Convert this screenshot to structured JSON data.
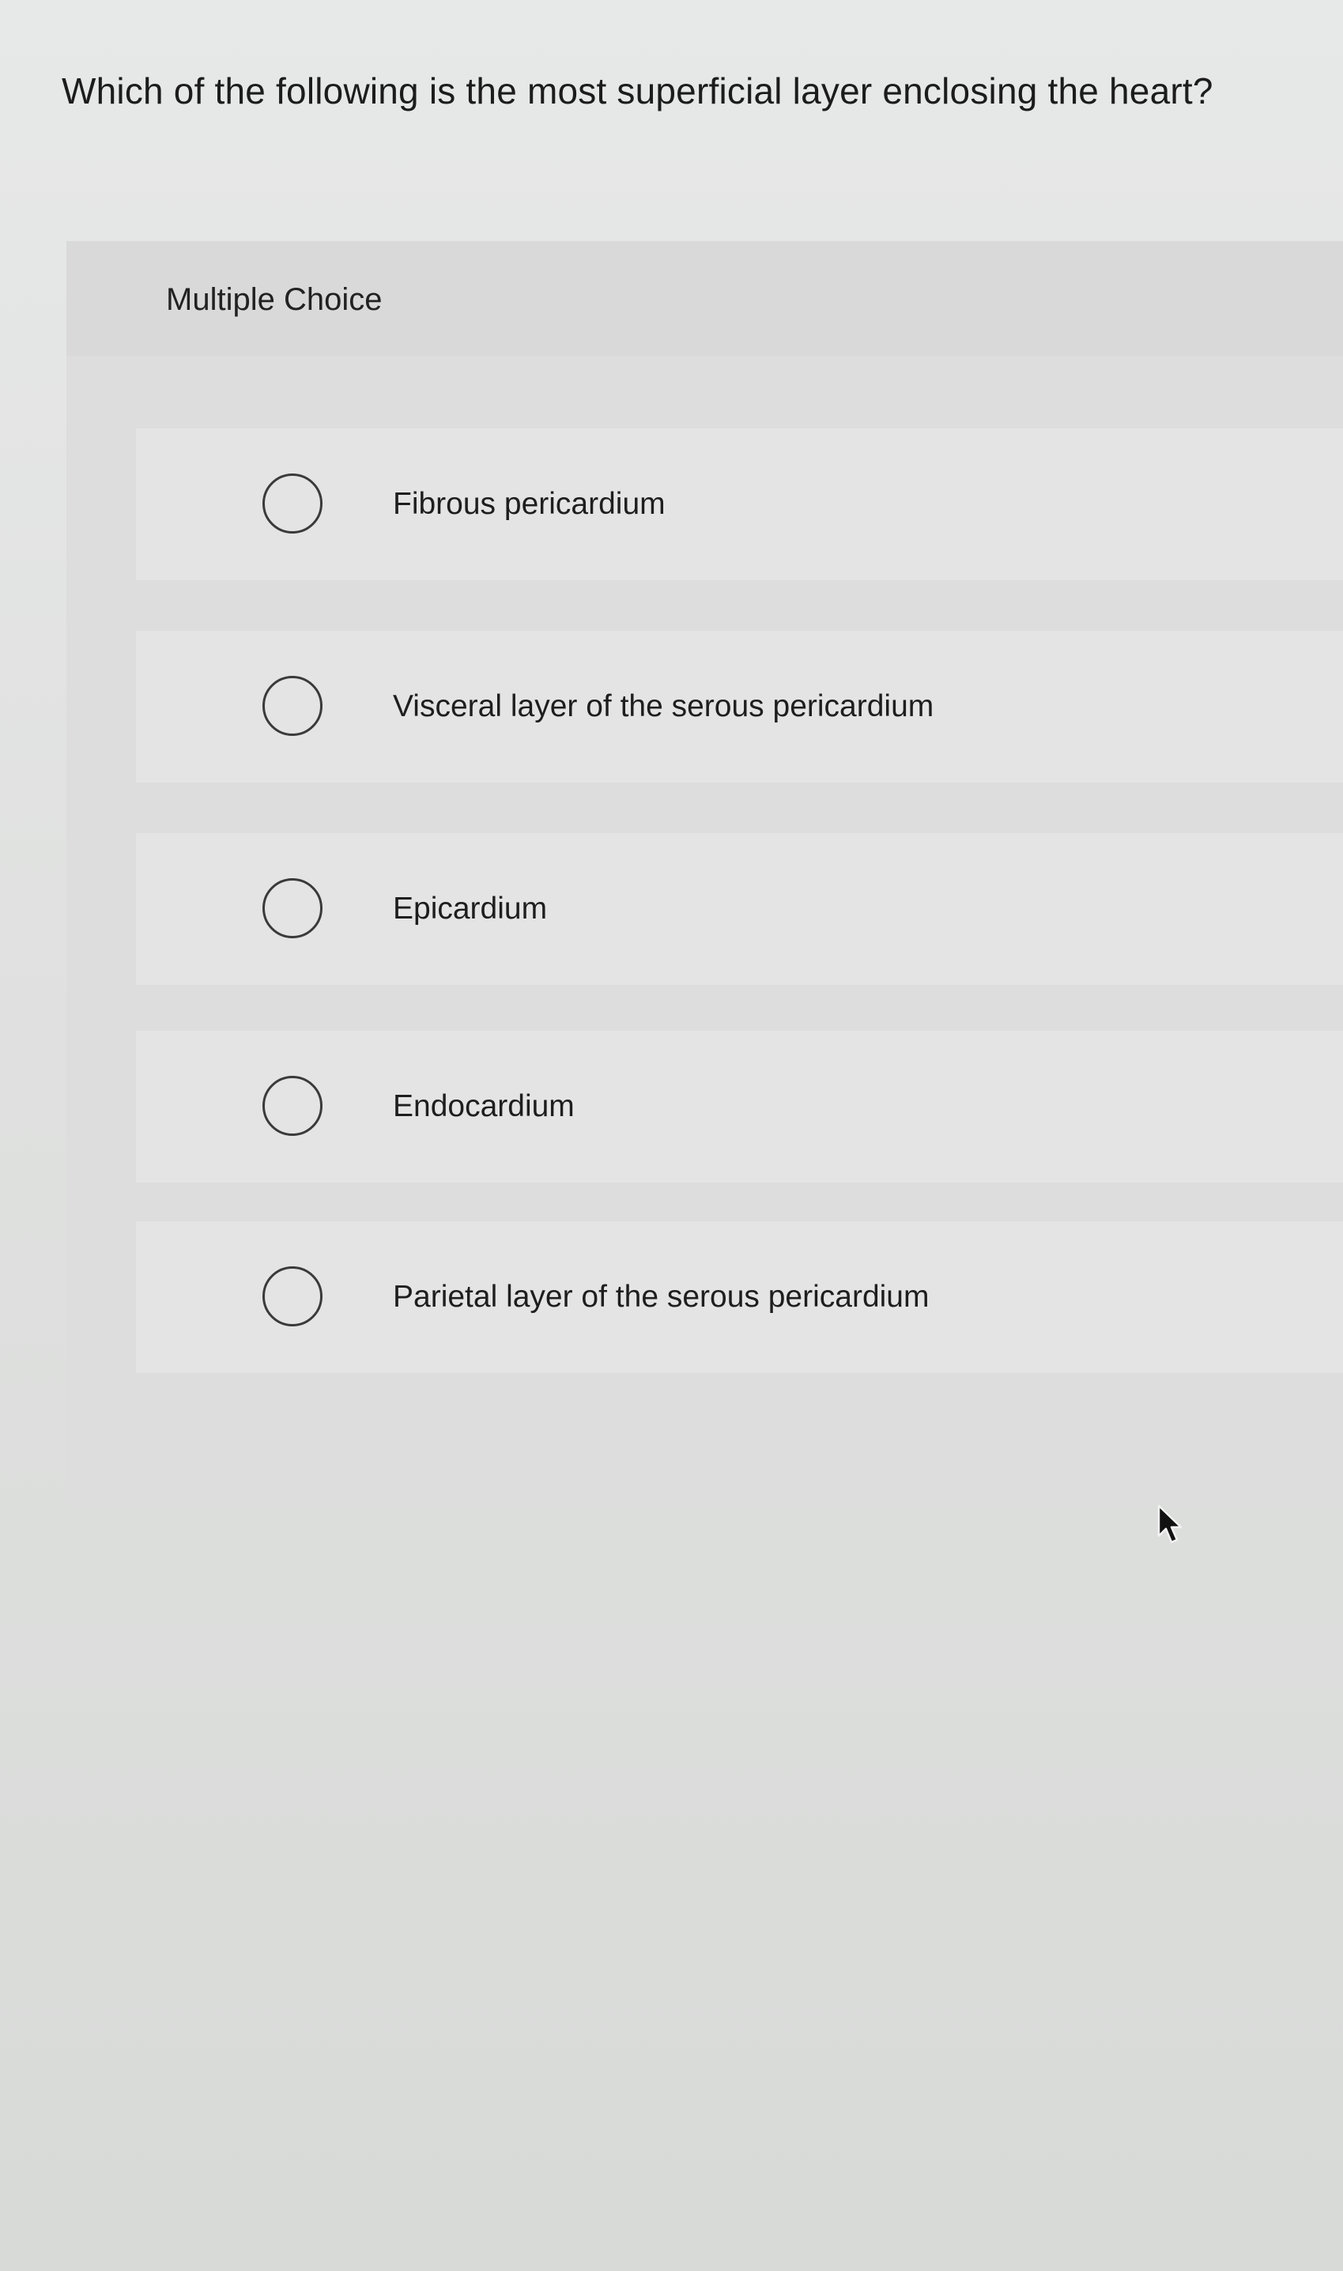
{
  "question": {
    "text": "Which of the following is the most superficial layer enclosing the heart?"
  },
  "panel": {
    "label": "Multiple Choice"
  },
  "options": [
    {
      "label": "Fibrous pericardium",
      "selected": false
    },
    {
      "label": "Visceral layer of the serous pericardium",
      "selected": false
    },
    {
      "label": "Epicardium",
      "selected": false
    },
    {
      "label": "Endocardium",
      "selected": false
    },
    {
      "label": "Parietal layer of the serous pericardium",
      "selected": false
    }
  ],
  "icons": {
    "radio": "radio-unselected-icon",
    "cursor": "mouse-pointer-icon"
  }
}
